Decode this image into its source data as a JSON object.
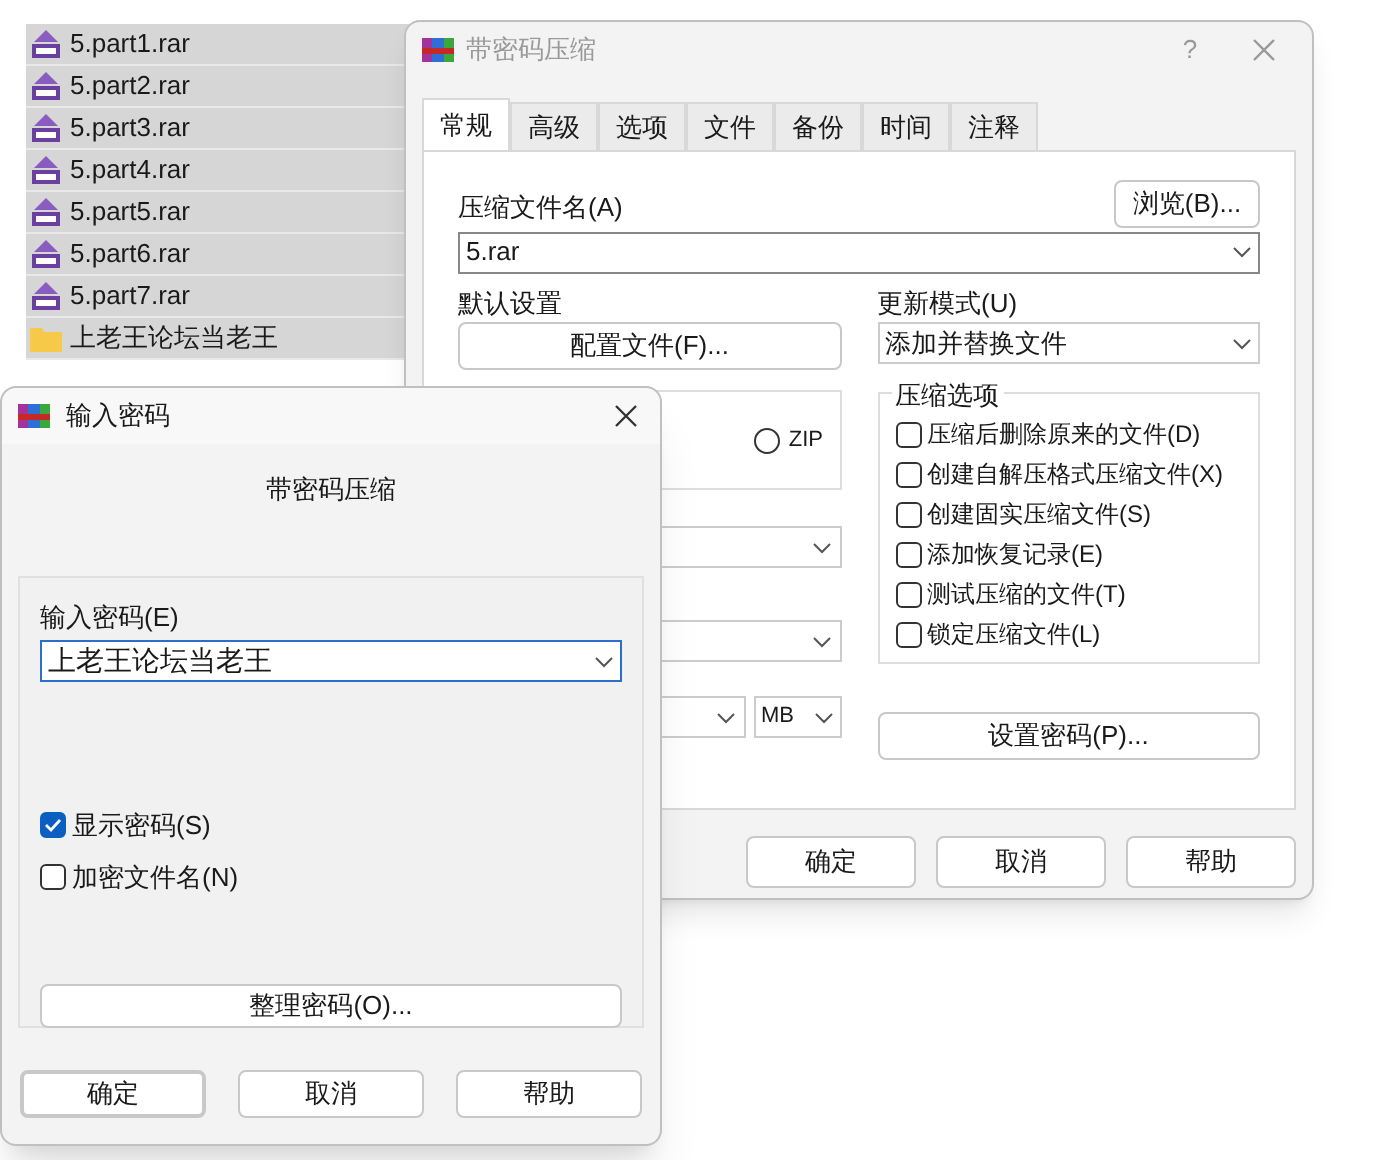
{
  "file_list": [
    {
      "name": "5.part1.rar",
      "kind": "archive",
      "selected": true
    },
    {
      "name": "5.part2.rar",
      "kind": "archive",
      "selected": true
    },
    {
      "name": "5.part3.rar",
      "kind": "archive",
      "selected": true
    },
    {
      "name": "5.part4.rar",
      "kind": "archive",
      "selected": true
    },
    {
      "name": "5.part5.rar",
      "kind": "archive",
      "selected": true
    },
    {
      "name": "5.part6.rar",
      "kind": "archive",
      "selected": true
    },
    {
      "name": "5.part7.rar",
      "kind": "archive",
      "selected": true
    },
    {
      "name": "上老王论坛当老王",
      "kind": "folder",
      "selected": true
    }
  ],
  "archive_dialog": {
    "title": "带密码压缩",
    "help_button": "?",
    "tabs": [
      {
        "label": "常规",
        "selected": true
      },
      {
        "label": "高级",
        "selected": false
      },
      {
        "label": "选项",
        "selected": false
      },
      {
        "label": "文件",
        "selected": false
      },
      {
        "label": "备份",
        "selected": false
      },
      {
        "label": "时间",
        "selected": false
      },
      {
        "label": "注释",
        "selected": false
      }
    ],
    "archive_name_label": "压缩文件名(A)",
    "browse_button": "浏览(B)...",
    "archive_name": "5.rar",
    "profiles_label": "默认设置",
    "profiles_button": "配置文件(F)...",
    "update_mode_label": "更新模式(U)",
    "update_mode": "添加并替换文件",
    "format_options": [
      {
        "label": "ZIP",
        "selected": false
      }
    ],
    "split_unit": "MB",
    "options_title": "压缩选项",
    "options": [
      {
        "label": "压缩后删除原来的文件(D)",
        "checked": false
      },
      {
        "label": "创建自解压格式压缩文件(X)",
        "checked": false
      },
      {
        "label": "创建固实压缩文件(S)",
        "checked": false
      },
      {
        "label": "添加恢复记录(E)",
        "checked": false
      },
      {
        "label": "测试压缩的文件(T)",
        "checked": false
      },
      {
        "label": "锁定压缩文件(L)",
        "checked": false
      }
    ],
    "password_button": "设置密码(P)...",
    "buttons": [
      "确定",
      "取消",
      "帮助"
    ]
  },
  "password_dialog": {
    "title": "输入密码",
    "heading": "带密码压缩",
    "password_label": "输入密码(E)",
    "password": "上老王论坛当老王",
    "checkboxes": [
      {
        "label": "显示密码(S)",
        "checked": true
      },
      {
        "label": "加密文件名(N)",
        "checked": false
      }
    ],
    "organize_button": "整理密码(O)...",
    "buttons": [
      {
        "label": "确定",
        "default": true
      },
      {
        "label": "取消",
        "default": false
      },
      {
        "label": "帮助",
        "default": false
      }
    ]
  }
}
